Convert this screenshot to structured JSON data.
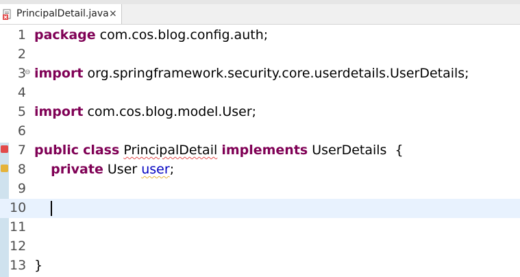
{
  "tab": {
    "label": "PrincipalDetail.java",
    "close_glyph": "×",
    "icon": "java-file-error-icon"
  },
  "lines": [
    {
      "num": "1",
      "tokens": [
        {
          "t": "package",
          "k": "kw"
        },
        {
          "t": " com.cos.blog.config.auth;"
        }
      ]
    },
    {
      "num": "2",
      "tokens": []
    },
    {
      "num": "3",
      "tokens": [
        {
          "t": "import",
          "k": "kw"
        },
        {
          "t": " org.springframework.security.core.userdetails.UserDetails;"
        }
      ]
    },
    {
      "num": "4",
      "tokens": []
    },
    {
      "num": "5",
      "tokens": [
        {
          "t": "import",
          "k": "kw"
        },
        {
          "t": " com.cos.blog.model.User;"
        }
      ]
    },
    {
      "num": "6",
      "tokens": []
    },
    {
      "num": "7",
      "tokens": [
        {
          "t": "public",
          "k": "kw"
        },
        {
          "t": " "
        },
        {
          "t": "class",
          "k": "kw"
        },
        {
          "t": " "
        },
        {
          "t": "PrincipalDetail",
          "s": "red"
        },
        {
          "t": " "
        },
        {
          "t": "implements",
          "k": "kw"
        },
        {
          "t": " UserDetails  {"
        }
      ]
    },
    {
      "num": "8",
      "tokens": [
        {
          "t": "    "
        },
        {
          "t": "private",
          "k": "kw"
        },
        {
          "t": " User "
        },
        {
          "t": "user",
          "k": "field",
          "s": "yellow"
        },
        {
          "t": ";"
        }
      ]
    },
    {
      "num": "9",
      "tokens": []
    },
    {
      "num": "10",
      "tokens": [],
      "current": true
    },
    {
      "num": "11",
      "tokens": []
    },
    {
      "num": "12",
      "tokens": []
    },
    {
      "num": "13",
      "tokens": [
        {
          "t": "}"
        }
      ]
    }
  ],
  "fold_glyph": "⊖",
  "colors": {
    "keyword": "#7f0055",
    "field": "#0000c0",
    "current_line": "#e8f2fe",
    "error": "#e24a4a",
    "warning": "#e5b33a"
  }
}
